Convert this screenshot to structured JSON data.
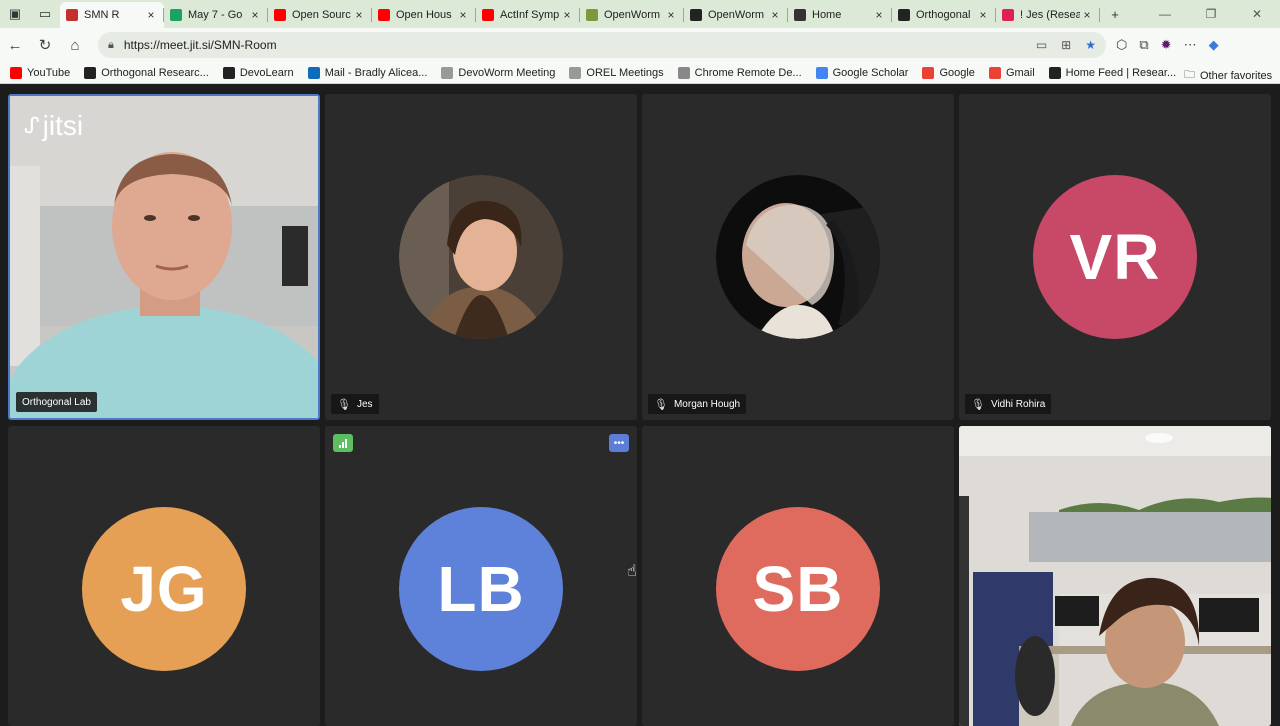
{
  "browser": {
    "tabs": [
      {
        "title": "SMN R",
        "color": "#c4302b",
        "active": true
      },
      {
        "title": "May 7 - Go",
        "color": "#1aa260"
      },
      {
        "title": "Open Sourc",
        "color": "#ff0000"
      },
      {
        "title": "Open Hous",
        "color": "#ff0000"
      },
      {
        "title": "ActInf Symp",
        "color": "#ff0000"
      },
      {
        "title": "OpenWorm",
        "color": "#7a9a3b"
      },
      {
        "title": "OpenWorm",
        "color": "#222222"
      },
      {
        "title": "Home",
        "color": "#333333"
      },
      {
        "title": "Orthogonal",
        "color": "#222222"
      },
      {
        "title": "! Jes (Resea",
        "color": "#e01e5a"
      }
    ],
    "new_tab": "+",
    "address": "https://meet.jit.si/SMN-Room",
    "bookmarks": [
      {
        "label": "YouTube",
        "color": "#ff0000"
      },
      {
        "label": "Orthogonal Researc...",
        "color": "#222222"
      },
      {
        "label": "DevoLearn",
        "color": "#222222"
      },
      {
        "label": "Mail - Bradly Alicea...",
        "color": "#0f6cbd"
      },
      {
        "label": "DevoWorm Meeting",
        "color": "#999999"
      },
      {
        "label": "OREL Meetings",
        "color": "#999999"
      },
      {
        "label": "Chrome Remote De...",
        "color": "#888888"
      },
      {
        "label": "Google Scholar",
        "color": "#4285f4"
      },
      {
        "label": "Google",
        "color": "#ea4335"
      },
      {
        "label": "Gmail",
        "color": "#ea4335"
      },
      {
        "label": "Home Feed | Resear...",
        "color": "#222222"
      }
    ],
    "other_favorites": "Other favorites"
  },
  "meeting": {
    "logo": "jitsi",
    "participants": [
      {
        "name": "Orthogonal Lab",
        "type": "video"
      },
      {
        "name": "Jes",
        "type": "photo",
        "muted": true
      },
      {
        "name": "Morgan Hough",
        "type": "photo",
        "muted": true
      },
      {
        "name": "Vidhi Rohira",
        "type": "initials",
        "initials": "VR",
        "color": "#c74867",
        "muted": true
      },
      {
        "name": "",
        "type": "initials",
        "initials": "JG",
        "color": "#e5a055"
      },
      {
        "name": "",
        "type": "initials",
        "initials": "LB",
        "color": "#5e82d9"
      },
      {
        "name": "",
        "type": "initials",
        "initials": "SB",
        "color": "#df6b5e"
      },
      {
        "name": "",
        "type": "video"
      }
    ]
  }
}
